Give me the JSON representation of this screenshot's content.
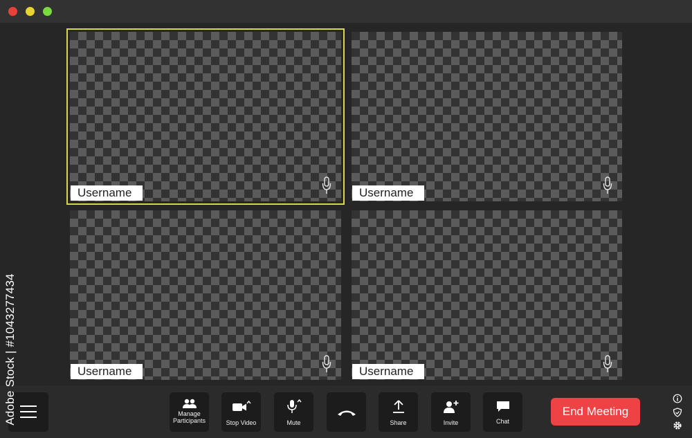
{
  "window": {
    "controls": [
      "close",
      "minimize",
      "maximize"
    ],
    "colors": {
      "close": "#e8413a",
      "minimize": "#e7d331",
      "maximize": "#79d93e"
    }
  },
  "participants": [
    {
      "name": "Username",
      "active": true,
      "mic_icon": "microphone-icon"
    },
    {
      "name": "Username",
      "active": false,
      "mic_icon": "microphone-icon"
    },
    {
      "name": "Username",
      "active": false,
      "mic_icon": "microphone-icon"
    },
    {
      "name": "Username",
      "active": false,
      "mic_icon": "microphone-icon"
    }
  ],
  "active_speaker_color": "#d8d94a",
  "toolbar": {
    "menu_icon": "hamburger-menu-icon",
    "buttons": [
      {
        "label": "Manage\nParticipants",
        "icon": "participants-icon"
      },
      {
        "label": "Stop Video",
        "icon": "video-camera-icon"
      },
      {
        "label": "Mute",
        "icon": "microphone-icon"
      },
      {
        "label": "",
        "icon": "hang-up-icon"
      },
      {
        "label": "Share",
        "icon": "share-upload-icon"
      },
      {
        "label": "Invite",
        "icon": "add-user-icon"
      },
      {
        "label": "Chat",
        "icon": "chat-bubble-icon"
      }
    ],
    "end_meeting": "End Meeting",
    "end_meeting_color": "#ee4244",
    "side_icons": [
      "info-icon",
      "shield-icon",
      "gear-icon"
    ]
  },
  "watermark": {
    "vertical_text": "Adobe Stock | #1043277434",
    "overlay": "Adobe Stock"
  }
}
